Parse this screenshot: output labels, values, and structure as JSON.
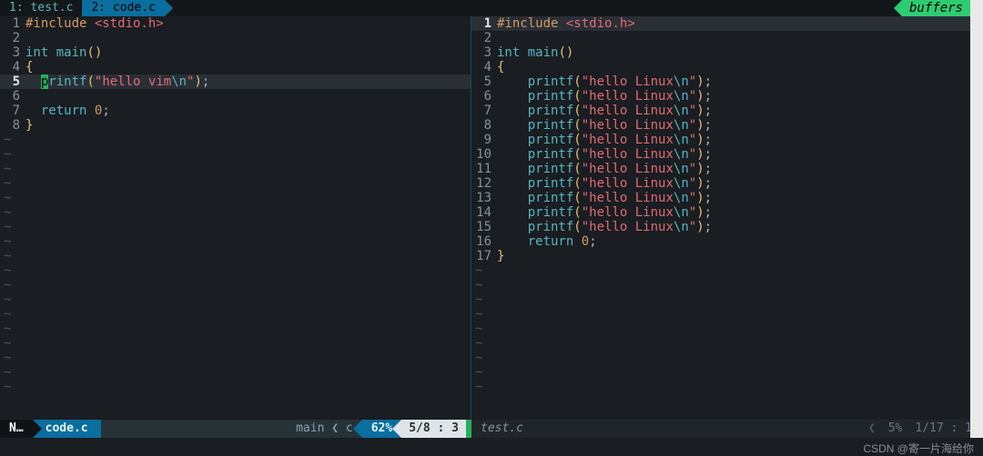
{
  "tabs": {
    "inactive": "1: test.c",
    "active": "2: code.c",
    "buffers": "buffers"
  },
  "left": {
    "lines": [
      {
        "n": "1",
        "tokens": [
          {
            "c": "preproc",
            "t": "#include "
          },
          {
            "c": "str",
            "t": "<stdio.h>"
          }
        ]
      },
      {
        "n": "2",
        "tokens": []
      },
      {
        "n": "3",
        "tokens": [
          {
            "c": "type",
            "t": "int"
          },
          {
            "c": "punct",
            "t": " "
          },
          {
            "c": "fn",
            "t": "main"
          },
          {
            "c": "br",
            "t": "()"
          }
        ]
      },
      {
        "n": "4",
        "tokens": [
          {
            "c": "br",
            "t": "{"
          }
        ]
      },
      {
        "n": "5",
        "hl": true,
        "boldnum": true,
        "tokens": [
          {
            "c": "punct",
            "t": "  "
          },
          {
            "c": "cursor",
            "t": "p"
          },
          {
            "c": "fn",
            "t": "rintf"
          },
          {
            "c": "br",
            "t": "("
          },
          {
            "c": "str",
            "t": "\"hello vim"
          },
          {
            "c": "esc",
            "t": "\\n"
          },
          {
            "c": "str",
            "t": "\""
          },
          {
            "c": "br",
            "t": ")"
          },
          {
            "c": "punct",
            "t": ";"
          }
        ]
      },
      {
        "n": "6",
        "tokens": []
      },
      {
        "n": "7",
        "tokens": [
          {
            "c": "punct",
            "t": "  "
          },
          {
            "c": "kw",
            "t": "return"
          },
          {
            "c": "punct",
            "t": " "
          },
          {
            "c": "num",
            "t": "0"
          },
          {
            "c": "punct",
            "t": ";"
          }
        ]
      },
      {
        "n": "8",
        "tokens": [
          {
            "c": "br",
            "t": "}"
          }
        ]
      }
    ],
    "empty_rows": 18
  },
  "right": {
    "lines": [
      {
        "n": "1",
        "hl": true,
        "boldnum": true,
        "tokens": [
          {
            "c": "preproc",
            "t": "#include "
          },
          {
            "c": "str",
            "t": "<stdio.h>"
          }
        ]
      },
      {
        "n": "2",
        "tokens": []
      },
      {
        "n": "3",
        "tokens": [
          {
            "c": "type",
            "t": "int"
          },
          {
            "c": "punct",
            "t": " "
          },
          {
            "c": "fn",
            "t": "main"
          },
          {
            "c": "br",
            "t": "()"
          }
        ]
      },
      {
        "n": "4",
        "tokens": [
          {
            "c": "br",
            "t": "{"
          }
        ]
      },
      {
        "n": "5",
        "tokens": [
          {
            "c": "punct",
            "t": "    "
          },
          {
            "c": "fn",
            "t": "printf"
          },
          {
            "c": "br",
            "t": "("
          },
          {
            "c": "str",
            "t": "\"hello Linux"
          },
          {
            "c": "esc",
            "t": "\\n"
          },
          {
            "c": "str",
            "t": "\""
          },
          {
            "c": "br",
            "t": ")"
          },
          {
            "c": "punct",
            "t": ";"
          }
        ]
      },
      {
        "n": "6",
        "tokens": [
          {
            "c": "punct",
            "t": "    "
          },
          {
            "c": "fn",
            "t": "printf"
          },
          {
            "c": "br",
            "t": "("
          },
          {
            "c": "str",
            "t": "\"hello Linux"
          },
          {
            "c": "esc",
            "t": "\\n"
          },
          {
            "c": "str",
            "t": "\""
          },
          {
            "c": "br",
            "t": ")"
          },
          {
            "c": "punct",
            "t": ";"
          }
        ]
      },
      {
        "n": "7",
        "tokens": [
          {
            "c": "punct",
            "t": "    "
          },
          {
            "c": "fn",
            "t": "printf"
          },
          {
            "c": "br",
            "t": "("
          },
          {
            "c": "str",
            "t": "\"hello Linux"
          },
          {
            "c": "esc",
            "t": "\\n"
          },
          {
            "c": "str",
            "t": "\""
          },
          {
            "c": "br",
            "t": ")"
          },
          {
            "c": "punct",
            "t": ";"
          }
        ]
      },
      {
        "n": "8",
        "tokens": [
          {
            "c": "punct",
            "t": "    "
          },
          {
            "c": "fn",
            "t": "printf"
          },
          {
            "c": "br",
            "t": "("
          },
          {
            "c": "str",
            "t": "\"hello Linux"
          },
          {
            "c": "esc",
            "t": "\\n"
          },
          {
            "c": "str",
            "t": "\""
          },
          {
            "c": "br",
            "t": ")"
          },
          {
            "c": "punct",
            "t": ";"
          }
        ]
      },
      {
        "n": "9",
        "tokens": [
          {
            "c": "punct",
            "t": "    "
          },
          {
            "c": "fn",
            "t": "printf"
          },
          {
            "c": "br",
            "t": "("
          },
          {
            "c": "str",
            "t": "\"hello Linux"
          },
          {
            "c": "esc",
            "t": "\\n"
          },
          {
            "c": "str",
            "t": "\""
          },
          {
            "c": "br",
            "t": ")"
          },
          {
            "c": "punct",
            "t": ";"
          }
        ]
      },
      {
        "n": "10",
        "tokens": [
          {
            "c": "punct",
            "t": "    "
          },
          {
            "c": "fn",
            "t": "printf"
          },
          {
            "c": "br",
            "t": "("
          },
          {
            "c": "str",
            "t": "\"hello Linux"
          },
          {
            "c": "esc",
            "t": "\\n"
          },
          {
            "c": "str",
            "t": "\""
          },
          {
            "c": "br",
            "t": ")"
          },
          {
            "c": "punct",
            "t": ";"
          }
        ]
      },
      {
        "n": "11",
        "tokens": [
          {
            "c": "punct",
            "t": "    "
          },
          {
            "c": "fn",
            "t": "printf"
          },
          {
            "c": "br",
            "t": "("
          },
          {
            "c": "str",
            "t": "\"hello Linux"
          },
          {
            "c": "esc",
            "t": "\\n"
          },
          {
            "c": "str",
            "t": "\""
          },
          {
            "c": "br",
            "t": ")"
          },
          {
            "c": "punct",
            "t": ";"
          }
        ]
      },
      {
        "n": "12",
        "tokens": [
          {
            "c": "punct",
            "t": "    "
          },
          {
            "c": "fn",
            "t": "printf"
          },
          {
            "c": "br",
            "t": "("
          },
          {
            "c": "str",
            "t": "\"hello Linux"
          },
          {
            "c": "esc",
            "t": "\\n"
          },
          {
            "c": "str",
            "t": "\""
          },
          {
            "c": "br",
            "t": ")"
          },
          {
            "c": "punct",
            "t": ";"
          }
        ]
      },
      {
        "n": "13",
        "tokens": [
          {
            "c": "punct",
            "t": "    "
          },
          {
            "c": "fn",
            "t": "printf"
          },
          {
            "c": "br",
            "t": "("
          },
          {
            "c": "str",
            "t": "\"hello Linux"
          },
          {
            "c": "esc",
            "t": "\\n"
          },
          {
            "c": "str",
            "t": "\""
          },
          {
            "c": "br",
            "t": ")"
          },
          {
            "c": "punct",
            "t": ";"
          }
        ]
      },
      {
        "n": "14",
        "tokens": [
          {
            "c": "punct",
            "t": "    "
          },
          {
            "c": "fn",
            "t": "printf"
          },
          {
            "c": "br",
            "t": "("
          },
          {
            "c": "str",
            "t": "\"hello Linux"
          },
          {
            "c": "esc",
            "t": "\\n"
          },
          {
            "c": "str",
            "t": "\""
          },
          {
            "c": "br",
            "t": ")"
          },
          {
            "c": "punct",
            "t": ";"
          }
        ]
      },
      {
        "n": "15",
        "tokens": [
          {
            "c": "punct",
            "t": "    "
          },
          {
            "c": "fn",
            "t": "printf"
          },
          {
            "c": "br",
            "t": "("
          },
          {
            "c": "str",
            "t": "\"hello Linux"
          },
          {
            "c": "esc",
            "t": "\\n"
          },
          {
            "c": "str",
            "t": "\""
          },
          {
            "c": "br",
            "t": ")"
          },
          {
            "c": "punct",
            "t": ";"
          }
        ]
      },
      {
        "n": "16",
        "tokens": [
          {
            "c": "punct",
            "t": "    "
          },
          {
            "c": "kw",
            "t": "return"
          },
          {
            "c": "punct",
            "t": " "
          },
          {
            "c": "num",
            "t": "0"
          },
          {
            "c": "punct",
            "t": ";"
          }
        ]
      },
      {
        "n": "17",
        "tokens": [
          {
            "c": "br",
            "t": "}"
          }
        ]
      }
    ],
    "empty_rows": 9
  },
  "status_left": {
    "mode": "N…",
    "file": "code.c",
    "mid": "main ❮ c",
    "pct": "62%",
    "pos": "5/8  :  3"
  },
  "status_right": {
    "file": "test.c",
    "pct": "5%",
    "pos": "1/17  :  1",
    "chev": "❮"
  },
  "watermark": "CSDN @寄一片海给你"
}
